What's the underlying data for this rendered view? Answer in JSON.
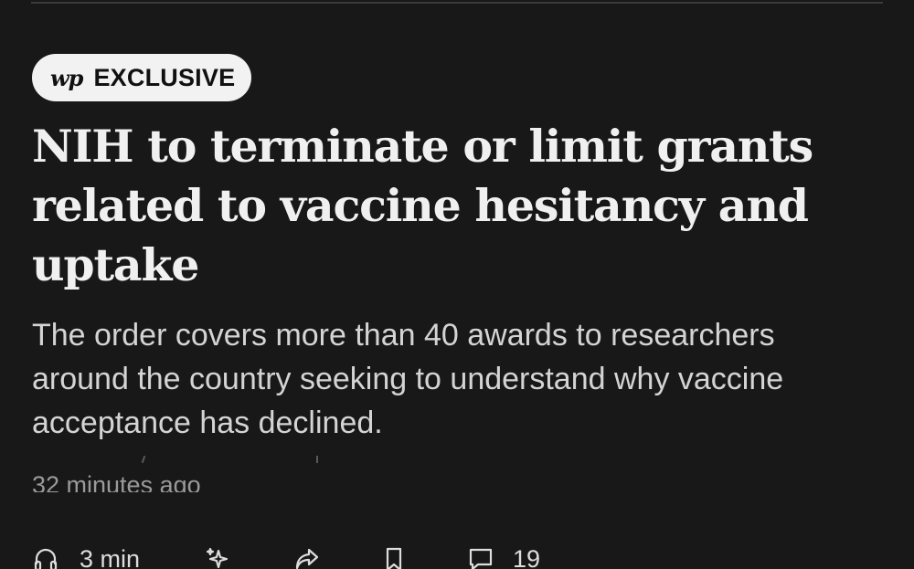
{
  "badge": {
    "logo": "wp",
    "label": "EXCLUSIVE"
  },
  "article": {
    "headline": "NIH to terminate or limit grants related to vaccine hesitancy and uptake",
    "dek": "The order covers more than 40 awards to researchers around the country seeking to understand why vaccine acceptance has declined.",
    "timestamp": "32 minutes ago"
  },
  "actions": {
    "listen_label": "3 min",
    "comment_count": "19"
  },
  "icons": {
    "listen": "headphones-icon",
    "ai": "sparkles-icon",
    "share": "share-arrow-icon",
    "save": "bookmark-icon",
    "comments": "comment-icon"
  },
  "colors": {
    "background": "#181818",
    "badge_bg": "#f2f2f2",
    "headline": "#f0f0f0",
    "dek": "#d4d4d4",
    "timestamp": "#9a9a9a"
  }
}
